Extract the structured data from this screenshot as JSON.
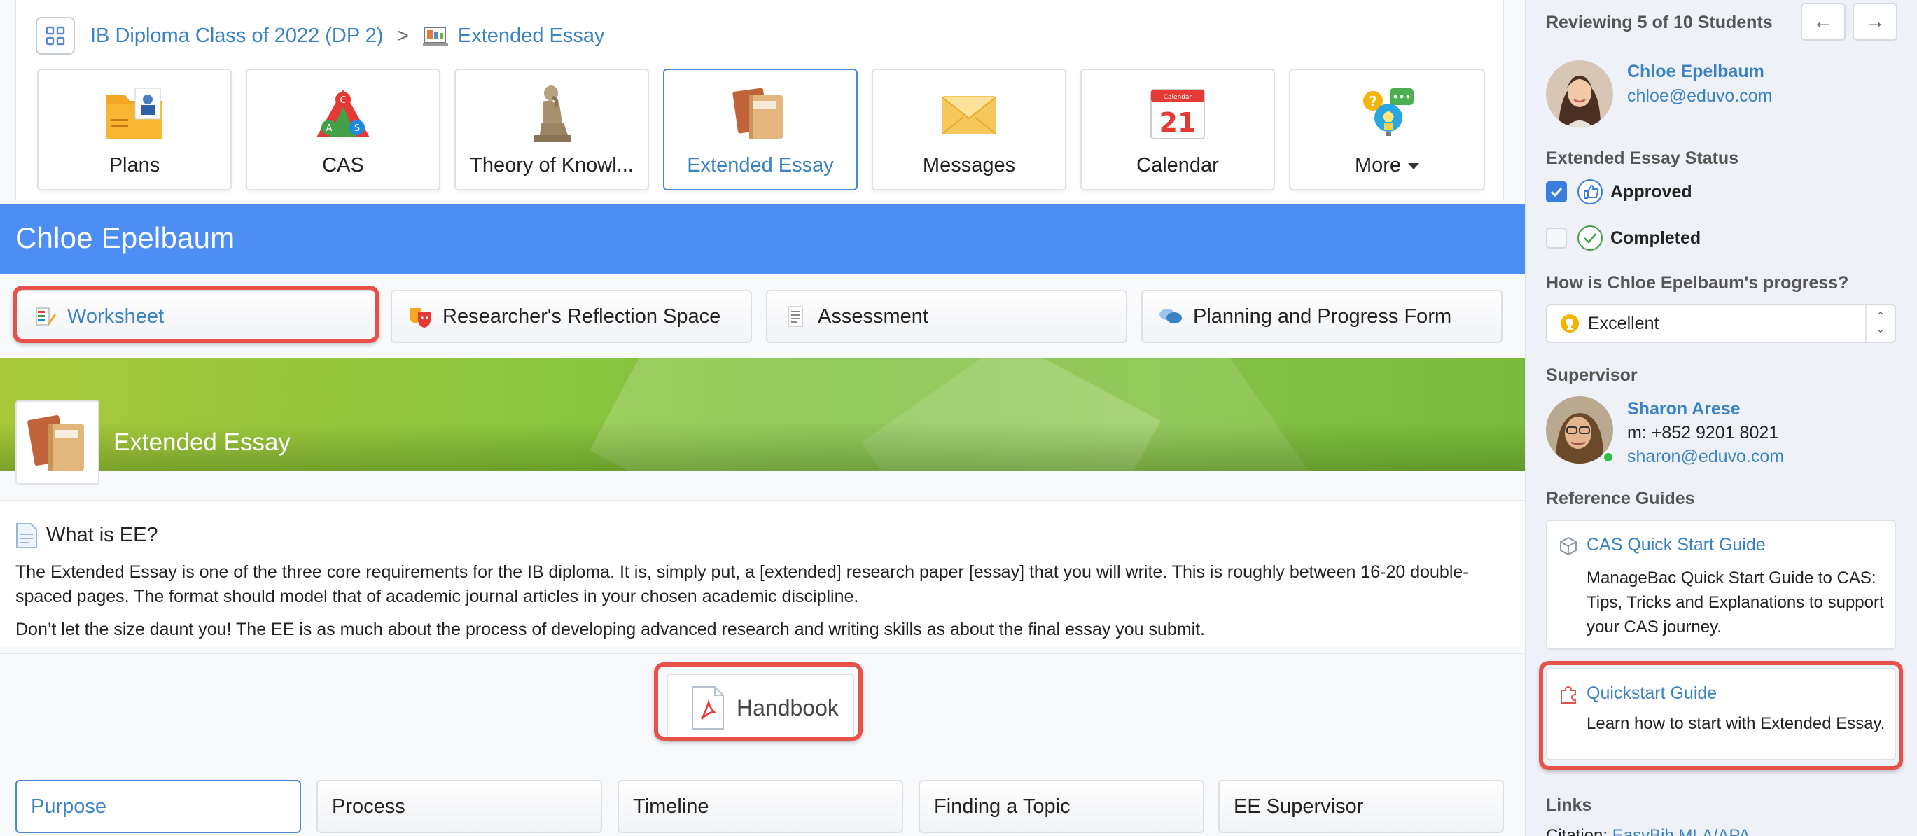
{
  "breadcrumb": {
    "class_name": "IB Diploma Class of 2022 (DP 2)",
    "separator": ">",
    "current": "Extended Essay"
  },
  "tiles": [
    {
      "label": "Plans",
      "icon": "plans-icon"
    },
    {
      "label": "CAS",
      "icon": "cas-icon"
    },
    {
      "label": "Theory of Knowl...",
      "icon": "thinker-icon"
    },
    {
      "label": "Extended Essay",
      "icon": "books-icon",
      "active": true
    },
    {
      "label": "Messages",
      "icon": "envelope-icon"
    },
    {
      "label": "Calendar",
      "icon": "calendar-icon",
      "calendar_day": "21",
      "calendar_header": "Calendar"
    },
    {
      "label": "More",
      "icon": "more-icon"
    }
  ],
  "student_banner": {
    "name": "Chloe Epelbaum"
  },
  "subtabs": [
    {
      "label": "Worksheet",
      "active": true,
      "highlighted": true
    },
    {
      "label": "Researcher's Reflection Space"
    },
    {
      "label": "Assessment"
    },
    {
      "label": "Planning and Progress Form"
    }
  ],
  "hero": {
    "title": "Extended Essay"
  },
  "content": {
    "heading": "What is EE?",
    "paragraph1": "The Extended Essay is one of the three core requirements for the IB diploma. It is, simply put, a [extended] research paper [essay] that you will write. This is roughly between 16-20 double-spaced pages. The format should model that of academic journal articles in your chosen academic discipline.",
    "paragraph2": "Don’t let the size daunt you! The EE is as much about the process of developing advanced research and writing skills as about the final essay you submit."
  },
  "handbook": {
    "label": "Handbook",
    "highlighted": true
  },
  "bottom_tabs": [
    {
      "label": "Purpose",
      "active": true
    },
    {
      "label": "Process"
    },
    {
      "label": "Timeline"
    },
    {
      "label": "Finding a Topic"
    },
    {
      "label": "EE Supervisor"
    }
  ],
  "sidebar": {
    "reviewing": "Reviewing 5 of 10 Students",
    "prev_arrow": "←",
    "next_arrow": "→",
    "student": {
      "name": "Chloe Epelbaum",
      "email": "chloe@eduvo.com"
    },
    "status_heading": "Extended Essay Status",
    "statuses": [
      {
        "label": "Approved",
        "checked": true
      },
      {
        "label": "Completed",
        "checked": false
      }
    ],
    "progress_question": "How is Chloe Epelbaum's progress?",
    "progress_value": "Excellent",
    "supervisor_heading": "Supervisor",
    "supervisor": {
      "name": "Sharon Arese",
      "phone": "m: +852 9201 8021",
      "email": "sharon@eduvo.com",
      "online": true
    },
    "guides_heading": "Reference Guides",
    "guides": [
      {
        "title": "CAS Quick Start Guide",
        "description": "ManageBac Quick Start Guide to CAS: Tips, Tricks and Explanations to support your CAS journey."
      },
      {
        "title": "Quickstart Guide",
        "description": "Learn how to start with Extended Essay.",
        "highlighted": true
      }
    ],
    "links_heading": "Links",
    "citation_label": "Citation:",
    "citation_link": "EasyBib MLA/APA"
  },
  "colors": {
    "banner": "#4d8ef5",
    "link": "#3b82c4",
    "highlight": "#e8504a",
    "sidebar_bg": "#eef2f8"
  }
}
